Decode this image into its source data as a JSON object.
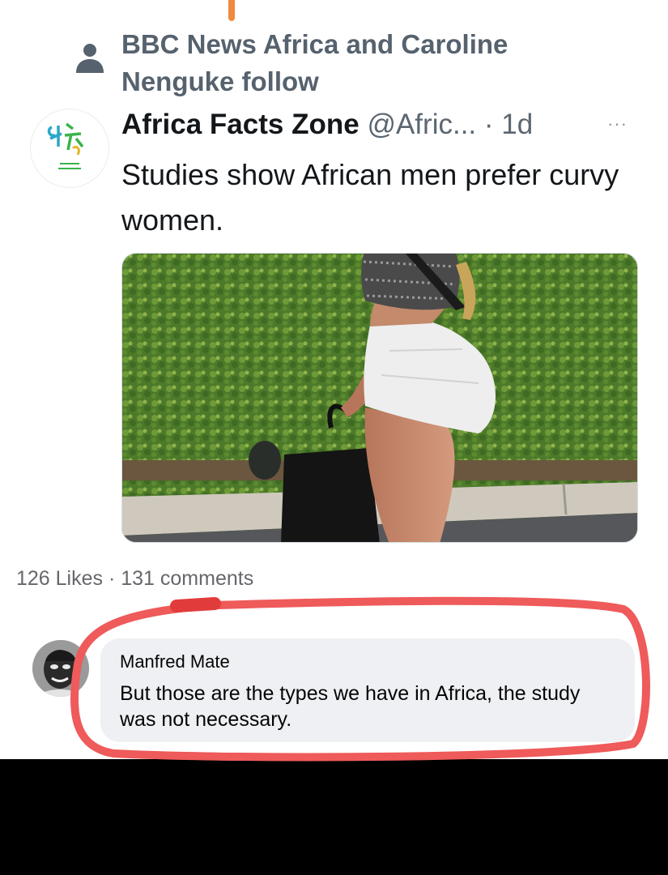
{
  "social_context": {
    "text": "BBC News Africa and Caroline Nenguke follow",
    "icon": "person-icon"
  },
  "tweet": {
    "author_name": "Africa Facts Zone",
    "handle_time": "@Afric... · 1d",
    "more_icon": "more-dots-icon",
    "text": "Studies show African men prefer curvy women.",
    "avatar_logo_text": "Africa Facts Zone",
    "media_description_icon": "tweet-photo"
  },
  "post_stats": {
    "text": "126 Likes · 131 comments"
  },
  "comment": {
    "author": "Manfred Mate",
    "text": "But those are the types we have in Africa, the study was not necessary."
  },
  "colors": {
    "highlight": "#ef5a5a",
    "top_mark": "#f08a3c",
    "bubble": "#eff0f3"
  }
}
